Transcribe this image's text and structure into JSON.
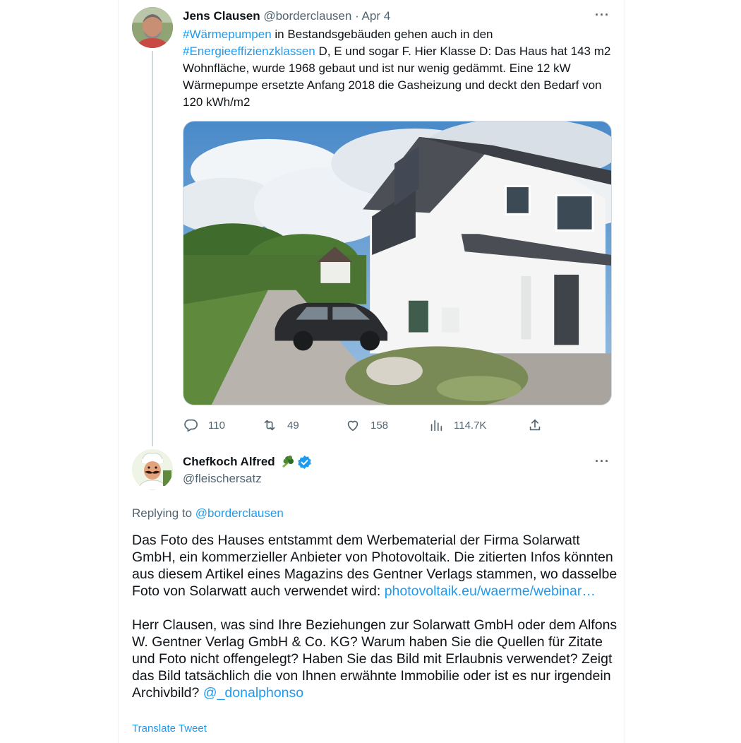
{
  "tweet": {
    "author_name": "Jens Clausen",
    "author_handle": "@borderclausen",
    "separator": "·",
    "time": "Apr 4",
    "more_label": "···",
    "text": {
      "hashtag1": "#Wärmepumpen",
      "t1": " in Bestandsgebäuden gehen auch in den ",
      "hashtag2": "#Energieeffizienzklassen",
      "t2": " D, E und sogar F. Hier Klasse D: Das Haus hat 143 m2 Wohnfläche, wurde 1968 gebaut und ist nur wenig gedämmt. Eine 12 kW Wärmepumpe ersetzte Anfang 2018 die Gasheizung und deckt den Bedarf von 120 kWh/m2"
    },
    "stats": {
      "replies": "110",
      "retweets": "49",
      "likes": "158",
      "views": "114.7K"
    }
  },
  "reply": {
    "author_name": "Chefkoch Alfred",
    "author_handle": "@fleischersatz",
    "more_label": "···",
    "replying_prefix": "Replying to ",
    "replying_to": "@borderclausen",
    "paragraph1": "Das Foto des Hauses entstammt dem Werbematerial der Firma Solarwatt GmbH, ein kommerzieller Anbieter von Photovoltaik. Die zitierten Infos könnten aus diesem Artikel eines Magazins des Gentner Verlags stammen, wo dasselbe Foto von Solarwatt auch verwendet wird: ",
    "link": "photovoltaik.eu/waerme/webinar…",
    "paragraph2": "Herr Clausen, was sind Ihre Beziehungen zur Solarwatt GmbH oder dem Alfons W. Gentner Verlag GmbH & Co. KG? Warum haben Sie die Quellen für Zitate und Foto nicht offengelegt? Haben Sie das Bild mit Erlaubnis verwendet? Zeigt das Bild tatsächlich die von Ihnen erwähnte Immobilie oder ist es nur irgendein Archivbild? ",
    "mention": "@_donalphonso",
    "translate_label": "Translate Tweet"
  },
  "colors": {
    "text": "#0f1419",
    "secondary": "#536471",
    "link": "#1d9bf0",
    "border": "#cfd9de"
  },
  "icons": [
    "more-icon",
    "reply-icon",
    "retweet-icon",
    "like-icon",
    "views-icon",
    "share-icon",
    "broccoli-emoji-icon",
    "verified-badge-icon"
  ]
}
